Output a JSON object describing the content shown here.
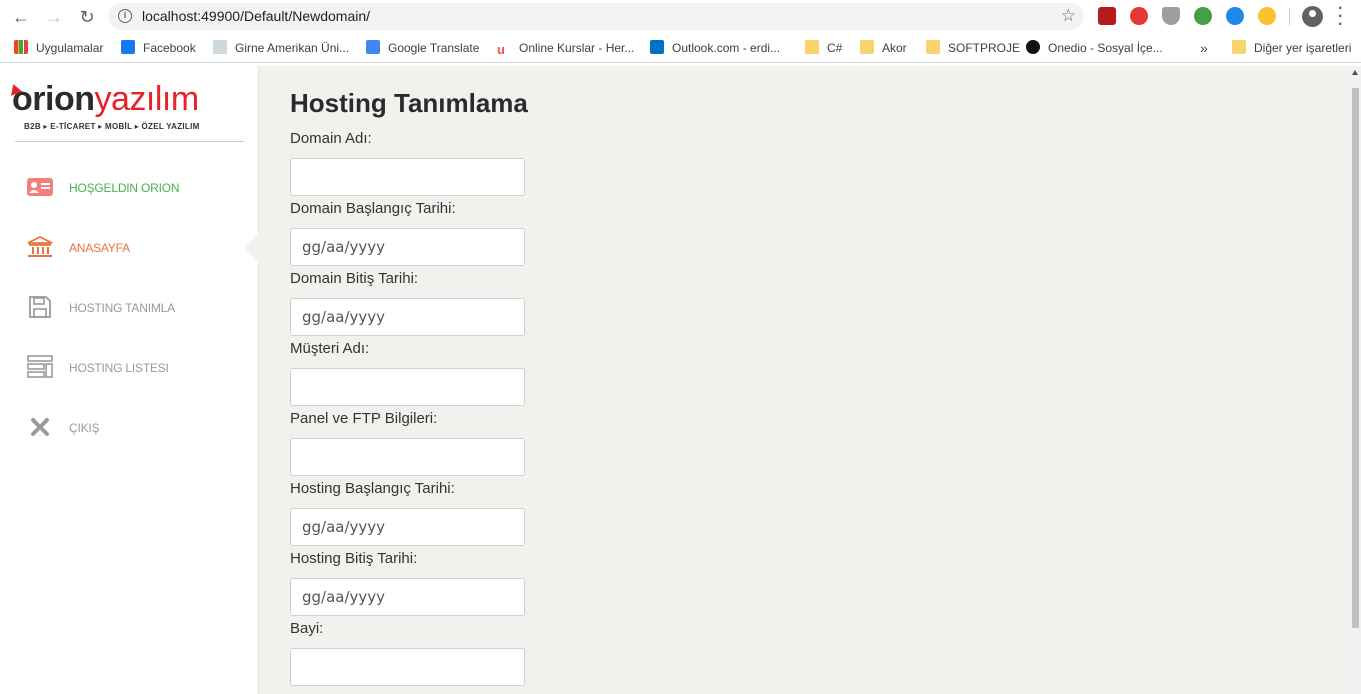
{
  "browser": {
    "url": "localhost:49900/Default/Newdomain/",
    "bookmarks": [
      {
        "label": "Uygulamalar",
        "icon": "apps-grid-icon"
      },
      {
        "label": "Facebook",
        "icon": "facebook-icon"
      },
      {
        "label": "Girne Amerikan Üni...",
        "icon": "page-icon"
      },
      {
        "label": "Google Translate",
        "icon": "translate-icon"
      },
      {
        "label": "Online Kurslar - Her...",
        "icon": "udemy-icon"
      },
      {
        "label": "Outlook.com - erdi...",
        "icon": "outlook-icon"
      },
      {
        "label": "C#",
        "icon": "folder-icon"
      },
      {
        "label": "Akor",
        "icon": "folder-icon"
      },
      {
        "label": "SOFTPROJE",
        "icon": "folder-icon"
      },
      {
        "label": "Onedio - Sosyal İçe...",
        "icon": "onedio-icon"
      }
    ],
    "more_label": "»",
    "other_bookmarks": "Diğer yer işaretleri"
  },
  "brand": {
    "name_part1": "orion",
    "name_part2": "yazılım",
    "tagline": "B2B ▸ E-TİCARET ▸ MOBİL ▸ ÖZEL YAZILIM",
    "red": "#e8222b"
  },
  "sidebar": {
    "items": [
      {
        "label": "HOŞGELDIN ORION",
        "icon": "user-card-icon",
        "color": "#4caf50"
      },
      {
        "label": "ANASAYFA",
        "icon": "bank-icon",
        "color": "#e8743b"
      },
      {
        "label": "HOSTING TANIMLA",
        "icon": "save-icon",
        "color": "#9a9a9a"
      },
      {
        "label": "HOSTING LISTESI",
        "icon": "list-icon",
        "color": "#9a9a9a"
      },
      {
        "label": "ÇIKIŞ",
        "icon": "close-icon",
        "color": "#9a9a9a"
      }
    ]
  },
  "form": {
    "title": "Hosting Tanımlama",
    "fields": [
      {
        "label": "Domain Adı:",
        "placeholder": ""
      },
      {
        "label": "Domain Başlangıç Tarihi:",
        "placeholder": "gg/aa/yyyy"
      },
      {
        "label": "Domain Bitiş Tarihi:",
        "placeholder": "gg/aa/yyyy"
      },
      {
        "label": "Müşteri Adı:",
        "placeholder": ""
      },
      {
        "label": "Panel ve FTP Bilgileri:",
        "placeholder": ""
      },
      {
        "label": "Hosting Başlangıç Tarihi:",
        "placeholder": "gg/aa/yyyy"
      },
      {
        "label": "Hosting Bitiş Tarihi:",
        "placeholder": "gg/aa/yyyy"
      },
      {
        "label": "Bayi:",
        "placeholder": ""
      }
    ]
  }
}
